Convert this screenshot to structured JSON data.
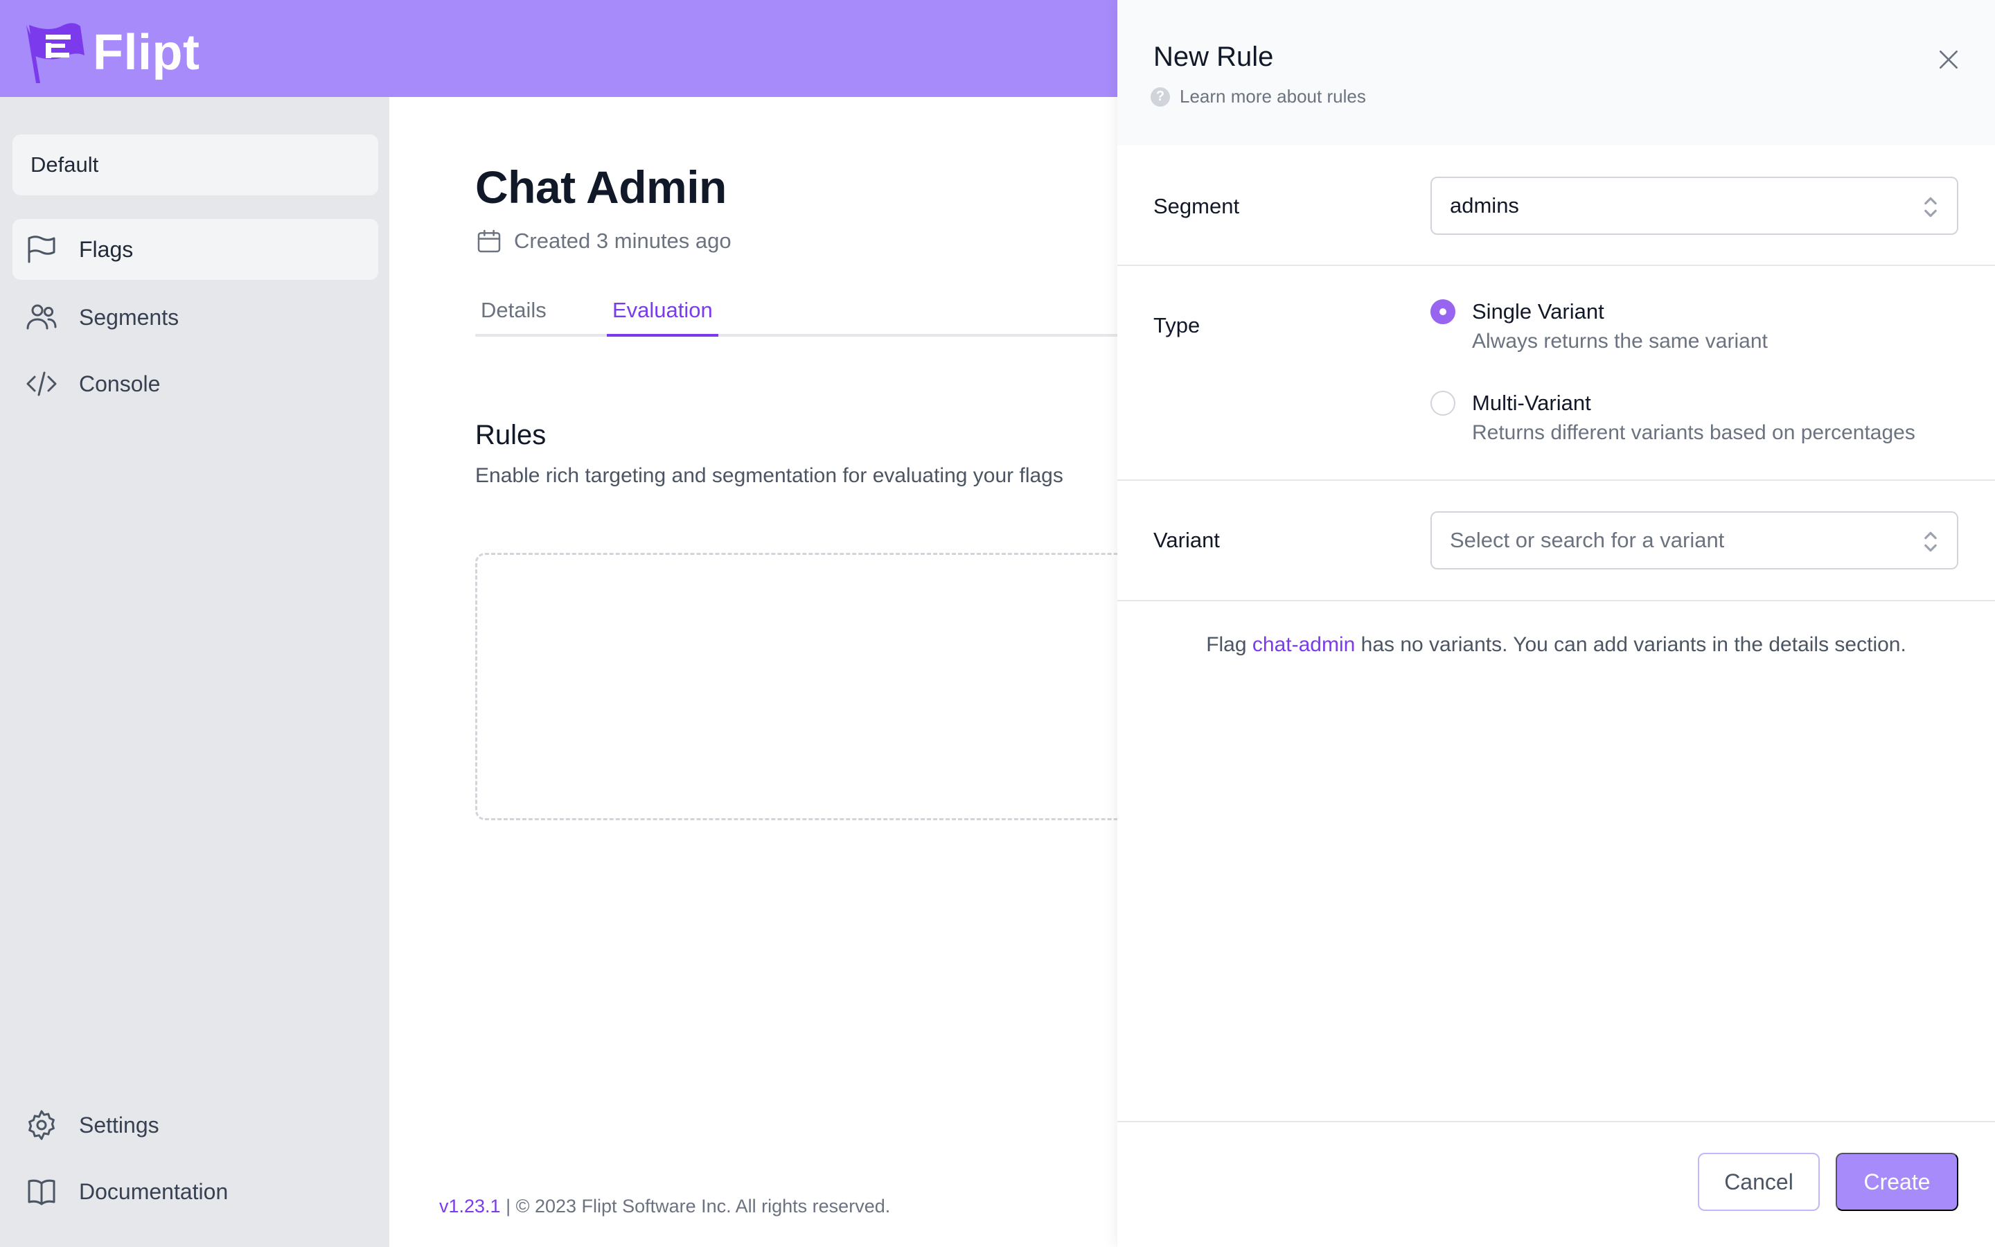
{
  "app": {
    "name": "Flipt",
    "brand_color": "#a78bfa",
    "accent_color": "#7c3aed"
  },
  "sidebar": {
    "namespace": "Default",
    "items": [
      {
        "label": "Flags",
        "icon": "flag-icon",
        "active": true
      },
      {
        "label": "Segments",
        "icon": "users-icon",
        "active": false
      },
      {
        "label": "Console",
        "icon": "code-icon",
        "active": false
      }
    ],
    "bottom_items": [
      {
        "label": "Settings",
        "icon": "gear-icon"
      },
      {
        "label": "Documentation",
        "icon": "book-icon"
      }
    ]
  },
  "main": {
    "title": "Chat Admin",
    "created": "Created 3 minutes ago",
    "tabs": [
      {
        "label": "Details",
        "active": false
      },
      {
        "label": "Evaluation",
        "active": true
      }
    ],
    "rules_title": "Rules",
    "rules_desc": "Enable rich targeting and segmentation for evaluating your flags"
  },
  "footer": {
    "version": "v1.23.1",
    "text": " | © 2023 Flipt Software Inc. All rights reserved."
  },
  "panel": {
    "title": "New Rule",
    "learn_more": "Learn more about rules",
    "segment": {
      "label": "Segment",
      "value": "admins"
    },
    "type": {
      "label": "Type",
      "options": [
        {
          "label": "Single Variant",
          "desc": "Always returns the same variant",
          "checked": true
        },
        {
          "label": "Multi-Variant",
          "desc": "Returns different variants based on percentages",
          "checked": false
        }
      ]
    },
    "variant": {
      "label": "Variant",
      "placeholder": "Select or search for a variant"
    },
    "note": {
      "prefix": "Flag ",
      "flag_key": "chat-admin",
      "suffix": " has no variants. You can add variants in the details section."
    },
    "buttons": {
      "cancel": "Cancel",
      "create": "Create"
    }
  }
}
